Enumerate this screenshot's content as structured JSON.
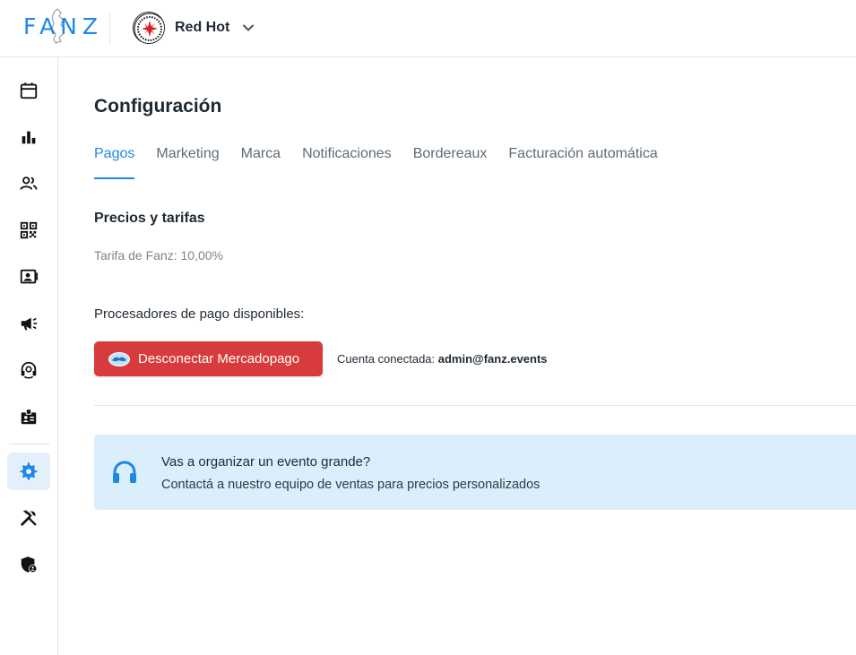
{
  "header": {
    "logo_text": "FANZ",
    "org_name": "Red Hot",
    "org_avatar_icon": "red-hot-chili-peppers-logo",
    "chevron_icon": "chevron-down-icon"
  },
  "sidebar": {
    "items": [
      {
        "name": "calendar",
        "icon": "calendar-icon"
      },
      {
        "name": "analytics",
        "icon": "bar-chart-icon"
      },
      {
        "name": "users",
        "icon": "users-icon"
      },
      {
        "name": "qr",
        "icon": "qr-code-icon"
      },
      {
        "name": "contacts",
        "icon": "contact-card-icon"
      },
      {
        "name": "marketing",
        "icon": "megaphone-icon"
      },
      {
        "name": "support",
        "icon": "headset-icon"
      },
      {
        "name": "staff",
        "icon": "badge-icon"
      },
      {
        "name": "settings",
        "icon": "gear-icon",
        "active": true
      },
      {
        "name": "tools",
        "icon": "tools-icon"
      },
      {
        "name": "admin",
        "icon": "shield-user-icon"
      }
    ]
  },
  "main": {
    "title": "Configuración",
    "tabs": [
      {
        "label": "Pagos",
        "active": true
      },
      {
        "label": "Marketing"
      },
      {
        "label": "Marca"
      },
      {
        "label": "Notificaciones"
      },
      {
        "label": "Bordereaux"
      },
      {
        "label": "Facturación automática"
      }
    ],
    "pricing": {
      "title": "Precios y tarifas",
      "fee_text": "Tarifa de Fanz: 10,00%"
    },
    "processors": {
      "label": "Procesadores de pago disponibles:",
      "disconnect_button": "Desconectar Mercadopago",
      "account_prefix": "Cuenta conectada:",
      "account_email": "admin@fanz.events"
    },
    "banner": {
      "title": "Vas a organizar un evento grande?",
      "text": "Contactá a nuestro equipo de ventas para precios personalizados",
      "icon": "headphones-icon"
    }
  },
  "colors": {
    "accent": "#1e88e5",
    "danger": "#d73b3b",
    "banner_bg": "#dbeefc",
    "active_nav_bg": "#e3f0fc"
  }
}
